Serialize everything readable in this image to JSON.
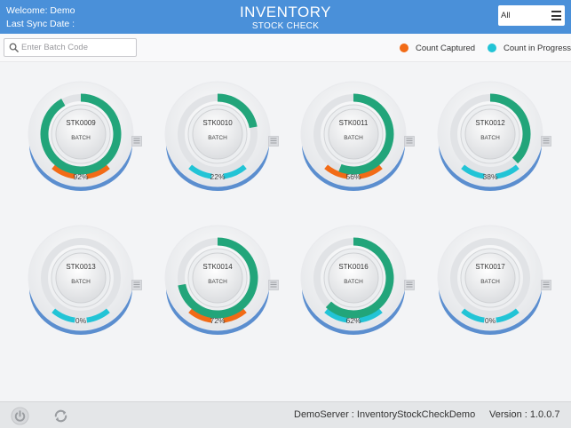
{
  "header": {
    "welcome": "Welcome:  Demo",
    "last_sync": "Last Sync Date :",
    "title": "INVENTORY",
    "subtitle": "STOCK CHECK",
    "filter_value": "All",
    "menu_icon": "hamburger-icon"
  },
  "search": {
    "placeholder": "Enter Batch Code",
    "icon": "search-icon",
    "value": ""
  },
  "legend": [
    {
      "label": "Count Captured",
      "color": "#f26b16"
    },
    {
      "label": "Count in Progress",
      "color": "#22c4d6"
    }
  ],
  "colors": {
    "progress_green": "#22a57a",
    "captured_orange": "#f26b16",
    "in_progress_cyan": "#22c4d6",
    "header_blue": "#4a90d9",
    "track_grey": "#e1e3e6"
  },
  "batches": [
    {
      "code": "STK0009",
      "label": "BATCH",
      "percent_text": "92%",
      "progress": 0.92,
      "status": "captured"
    },
    {
      "code": "STK0010",
      "label": "BATCH",
      "percent_text": "22%",
      "progress": 0.22,
      "status": "in_progress"
    },
    {
      "code": "STK0011",
      "label": "BATCH",
      "percent_text": "56%",
      "progress": 0.56,
      "status": "captured"
    },
    {
      "code": "STK0012",
      "label": "BATCH",
      "percent_text": "38%",
      "progress": 0.38,
      "status": "in_progress"
    },
    {
      "code": "STK0013",
      "label": "BATCH",
      "percent_text": "0%",
      "progress": 0,
      "status": "in_progress"
    },
    {
      "code": "STK0014",
      "label": "BATCH",
      "percent_text": "72%",
      "progress": 0.72,
      "status": "captured"
    },
    {
      "code": "STK0016",
      "label": "BATCH",
      "percent_text": "62%",
      "progress": 0.62,
      "status": "in_progress"
    },
    {
      "code": "STK0017",
      "label": "BATCH",
      "percent_text": "0%",
      "progress": 0,
      "status": "in_progress"
    }
  ],
  "footer": {
    "server": "DemoServer : InventoryStockCheckDemo",
    "version": "Version : 1.0.0.7",
    "power_icon": "power-icon",
    "sync_icon": "sync-icon"
  }
}
